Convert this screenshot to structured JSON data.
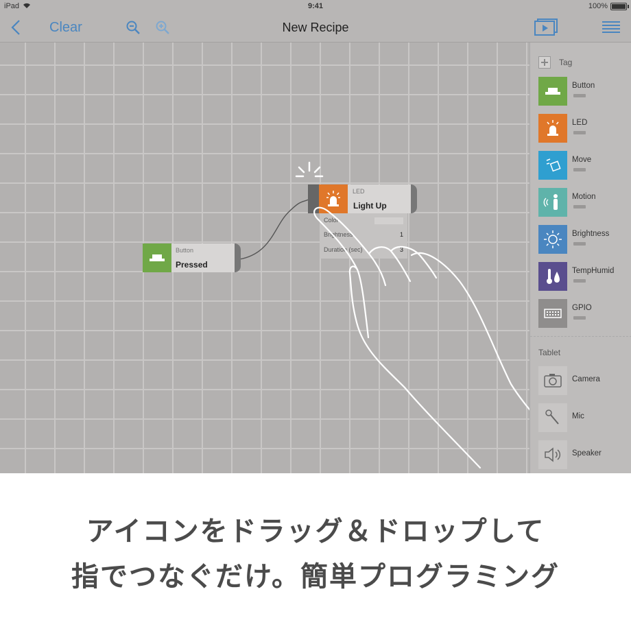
{
  "status_bar": {
    "device": "iPad",
    "time": "9:41",
    "battery": "100%"
  },
  "nav": {
    "clear_label": "Clear",
    "title": "New Recipe"
  },
  "canvas": {
    "button_block": {
      "type": "Button",
      "name": "Pressed"
    },
    "led_block": {
      "type": "LED",
      "name": "Light Up",
      "props": [
        {
          "label": "Color",
          "value": ""
        },
        {
          "label": "Brightness",
          "value": "1"
        },
        {
          "label": "Duration (sec)",
          "value": "3"
        }
      ]
    }
  },
  "sidebar": {
    "tag_label": "Tag",
    "tag_items": [
      {
        "label": "Button",
        "color": "#70a847",
        "icon": "button-icon"
      },
      {
        "label": "LED",
        "color": "#e0772a",
        "icon": "led-icon"
      },
      {
        "label": "Move",
        "color": "#2f9fd0",
        "icon": "move-icon"
      },
      {
        "label": "Motion",
        "color": "#5fb3aa",
        "icon": "motion-icon"
      },
      {
        "label": "Brightness",
        "color": "#4a86c0",
        "icon": "brightness-icon"
      },
      {
        "label": "TempHumid",
        "color": "#5a4e8e",
        "icon": "temphumid-icon"
      },
      {
        "label": "GPIO",
        "color": "#8f8d8c",
        "icon": "gpio-icon"
      }
    ],
    "tablet_label": "Tablet",
    "tablet_items": [
      {
        "label": "Camera",
        "icon": "camera-icon"
      },
      {
        "label": "Mic",
        "icon": "mic-icon"
      },
      {
        "label": "Speaker",
        "icon": "speaker-icon"
      }
    ]
  },
  "caption": {
    "line1": "アイコンをドラッグ＆ドロップして",
    "line2": "指でつなぐだけ。簡単プログラミング"
  }
}
